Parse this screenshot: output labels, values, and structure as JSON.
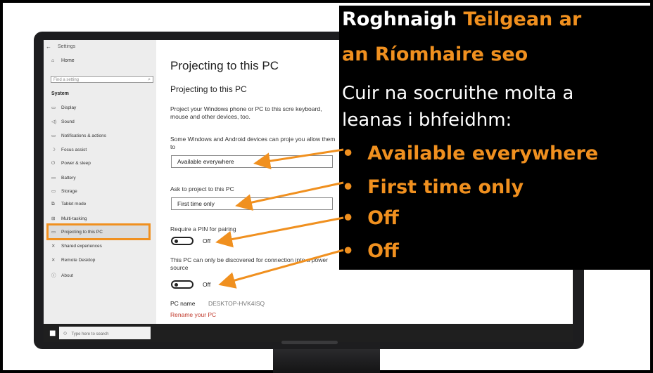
{
  "window": {
    "back_icon": "←",
    "title": "Settings"
  },
  "sidebar": {
    "home": "Home",
    "search_placeholder": "Find a setting",
    "section": "System",
    "items": [
      {
        "icon": "▭",
        "label": "Display"
      },
      {
        "icon": "◁)",
        "label": "Sound"
      },
      {
        "icon": "▭",
        "label": "Notifications & actions"
      },
      {
        "icon": "☽",
        "label": "Focus assist"
      },
      {
        "icon": "⏻",
        "label": "Power & sleep"
      },
      {
        "icon": "▭",
        "label": "Battery"
      },
      {
        "icon": "▭",
        "label": "Storage"
      },
      {
        "icon": "⧉",
        "label": "Tablet mode"
      },
      {
        "icon": "⊞",
        "label": "Multi-tasking"
      },
      {
        "icon": "▭",
        "label": "Projecting to this PC"
      },
      {
        "icon": "✕",
        "label": "Shared experiences"
      },
      {
        "icon": "✕",
        "label": "Remote Desktop"
      },
      {
        "icon": "ⓘ",
        "label": "About"
      }
    ],
    "selected_index": 9
  },
  "taskbar": {
    "start_icon": "■",
    "search_placeholder": "Type here to search"
  },
  "content": {
    "page_title": "Projecting to this PC",
    "section_title": "Projecting to this PC",
    "intro": "Project your Windows phone or PC to this scre keyboard, mouse and other devices, too.",
    "availability_desc": "Some Windows and Android devices can proje you allow them to",
    "availability_value": "Available everywhere",
    "ask_label": "Ask to project to this PC",
    "ask_value": "First time only",
    "pin_label": "Require a PIN for pairing",
    "pin_toggle": "Off",
    "power_desc": "This PC can only be discovered for connection into a power source",
    "power_toggle": "Off",
    "pc_name_label": "PC name",
    "pc_name_value": "DESKTOP-HVK4ISQ",
    "rename_link": "Rename your PC"
  },
  "overlay": {
    "title_white": "Roghnaigh",
    "title_orange_1": "Teilgean ar",
    "title_orange_2": "an Ríomhaire seo",
    "body_1": "Cuir na socruithe molta a",
    "body_2": "leanas i bhfeidhm:",
    "bullets": [
      "Available everywhere",
      "First time only",
      "Off",
      "Off"
    ],
    "bullet_char": "•",
    "accent_color": "#f0901f"
  }
}
